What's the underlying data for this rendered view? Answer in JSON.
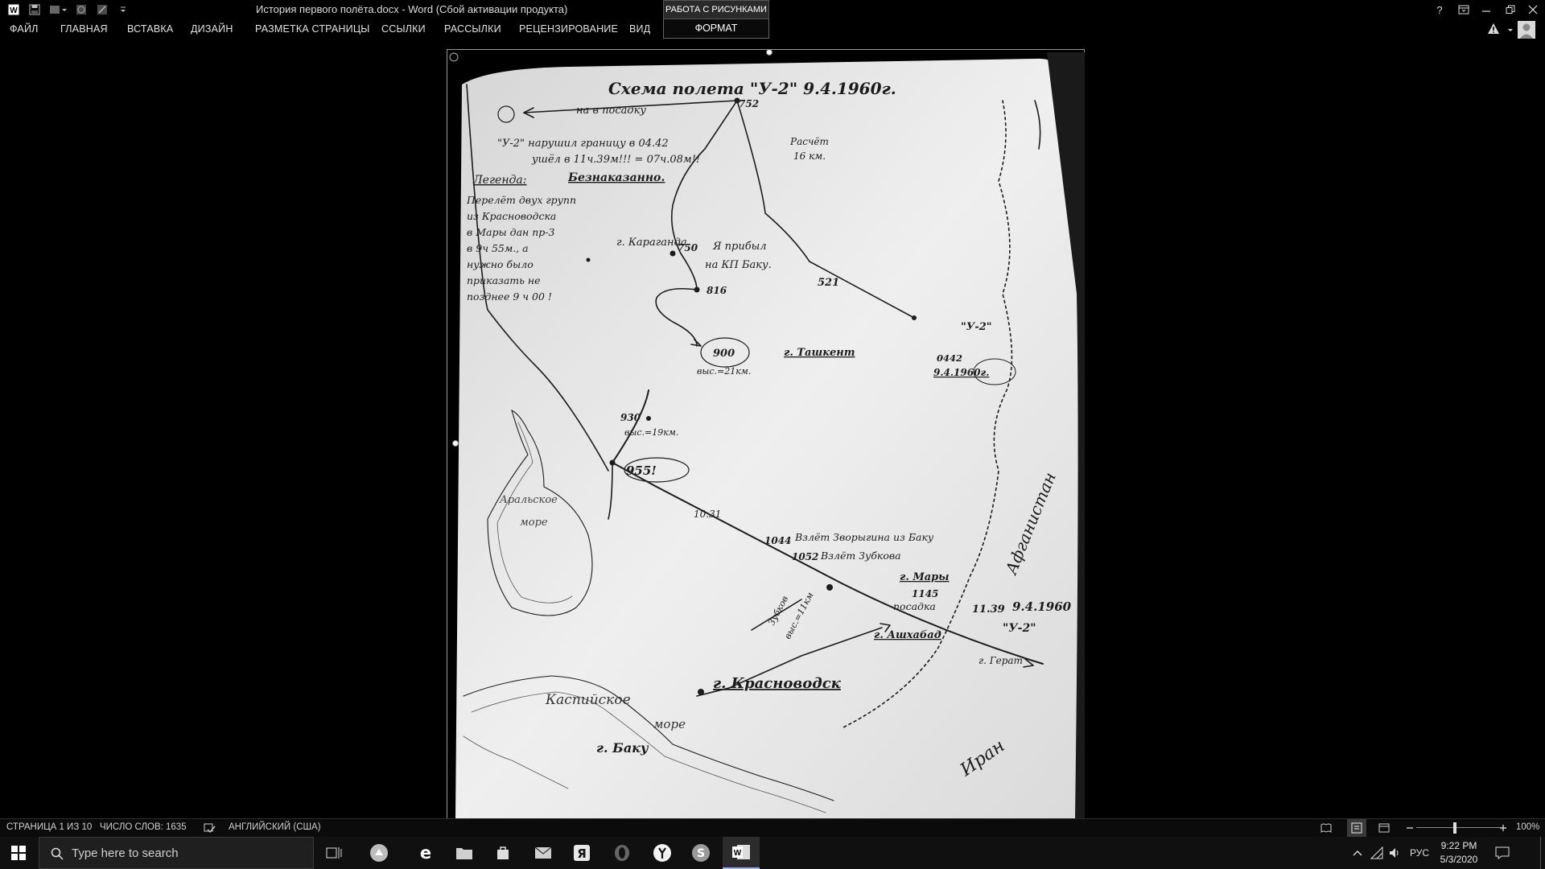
{
  "window": {
    "title": "История первого полёта.docx - Word (Сбой активации продукта)",
    "context_group": "РАБОТА С РИСУНКАМИ",
    "help": "?"
  },
  "ribbon": {
    "tabs": [
      {
        "label": "ФАЙЛ"
      },
      {
        "label": "ГЛАВНАЯ"
      },
      {
        "label": "ВСТАВКА"
      },
      {
        "label": "ДИЗАЙН"
      },
      {
        "label": "РАЗМЕТКА СТРАНИЦЫ"
      },
      {
        "label": "ССЫЛКИ"
      },
      {
        "label": "РАССЫЛКИ"
      },
      {
        "label": "РЕЦЕНЗИРОВАНИЕ"
      },
      {
        "label": "ВИД"
      }
    ],
    "contextual_tab": "ФОРМАТ"
  },
  "sketch": {
    "title": "Схема полета \"У-2\" 9.4.1960г.",
    "top_route_note": "на в посадку",
    "record_note_1": "\"У-2\" нарушил границу в 04.42",
    "record_note_2": "ушёл в 11ч.39м!!! = 07ч.08м!!",
    "legend_label": "Легенда:",
    "legend_value": "Безнаказанно.",
    "side_note": [
      "Перелёт двух групп",
      "из Красноводска",
      "в Мары дан пр-3",
      "в 9ч 55м., а",
      "нужно было",
      "приказать не",
      "позднее 9 ч 00 !"
    ],
    "karaganda": "г. Караганда",
    "t750": "750",
    "arrived_note": [
      "Я прибыл",
      "на КП Баку."
    ],
    "t752": "752",
    "distance_note": [
      "Расчёт",
      "16 км."
    ],
    "t816": "816",
    "t521": "521",
    "t900": "900",
    "height_900": "выс.=21км.",
    "t930": "930",
    "height_930": "выс.=19км.",
    "t955": "955!",
    "tashkent": "г. Ташкент",
    "u2_label": "\"У-2\"",
    "start_time": "0442",
    "start_date": "9.4.1960г.",
    "aral_sea": [
      "Аральское",
      "море"
    ],
    "t1031": "10.31",
    "t1044": "1044",
    "takeoff_baku": "Взлёт Зворыгина из Баку",
    "t1052": "1052",
    "takeoff_zubkov": "Взлёт Зубкова",
    "zubkov_route": [
      "Зубков",
      "выс.=11км"
    ],
    "mary": "г. Мары",
    "t1145": "1145",
    "landing": "посадка",
    "exit_time": "11.39",
    "exit_date": "9.4.1960",
    "u2_exit": "\"У-2\"",
    "ashgabat": "г. Ашхабад",
    "herat": "г. Герат",
    "afghanistan": "Афганистан",
    "krasnovodsk": "г. Красноводск",
    "caspian": [
      "Каспийское",
      "море"
    ],
    "baku": "г. Баку",
    "iran": "Иран"
  },
  "statusbar": {
    "page": "СТРАНИЦА 1 ИЗ 10",
    "words": "ЧИСЛО СЛОВ: 1635",
    "language": "АНГЛИЙСКИЙ (США)",
    "zoom": "100%"
  },
  "taskbar": {
    "search_placeholder": "Type here to search",
    "lang": "РУС",
    "time": "9:22 PM",
    "date": "5/3/2020"
  },
  "colors": {
    "background": "#000000",
    "paper": "#e9e9e9",
    "ink": "#1c1c1c",
    "active_app": "#8ab4ff"
  }
}
